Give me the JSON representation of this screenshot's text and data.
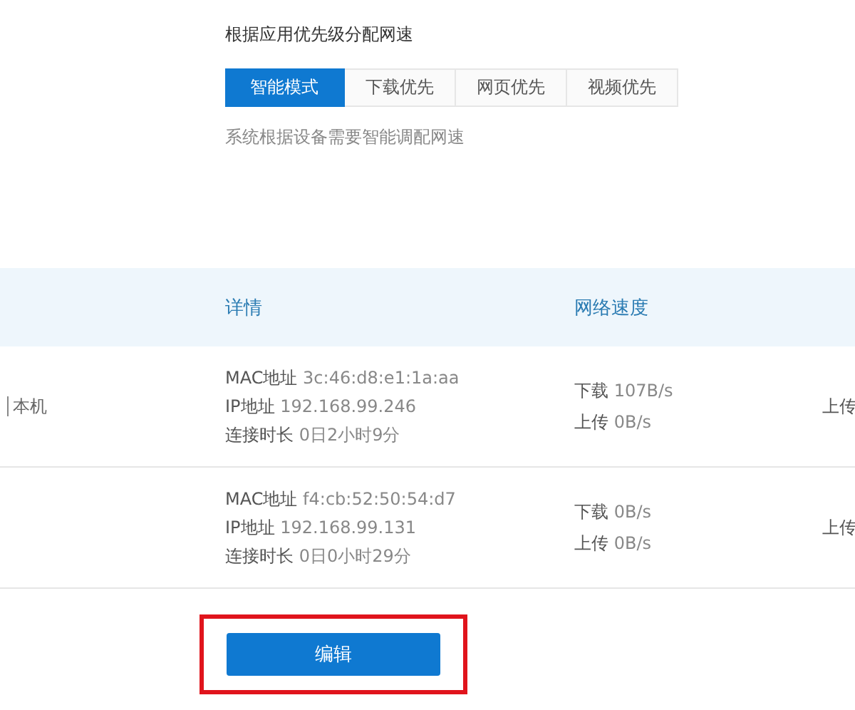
{
  "priority": {
    "title": "根据应用优先级分配网速",
    "tabs": [
      {
        "label": "智能模式",
        "selected": true
      },
      {
        "label": "下载优先",
        "selected": false
      },
      {
        "label": "网页优先",
        "selected": false
      },
      {
        "label": "视频优先",
        "selected": false
      }
    ],
    "description": "系统根据设备需要智能调配网速"
  },
  "table": {
    "columns": [
      "详情",
      "网络速度"
    ],
    "rows": [
      {
        "column_1": "本机",
        "details": [
          {
            "label": "MAC地址",
            "value": "3c:46:d8:e1:1a:aa"
          },
          {
            "label": "IP地址",
            "value": "192.168.99.246"
          },
          {
            "label": "连接时长",
            "value": "0日2小时9分"
          }
        ],
        "speed": [
          {
            "label": "下载",
            "value": "107B/s"
          },
          {
            "label": "上传",
            "value": "0B/s"
          }
        ],
        "column_4": "上传"
      },
      {
        "details": [
          {
            "label": "MAC地址",
            "value": "f4:cb:52:50:54:d7"
          },
          {
            "label": "IP地址",
            "value": "192.168.99.131"
          },
          {
            "label": "连接时长",
            "value": "0日0小时29分"
          }
        ],
        "speed": [
          {
            "label": "下载",
            "value": "0B/s"
          },
          {
            "label": "上传",
            "value": "0B/s"
          }
        ],
        "column_4": "上传"
      }
    ]
  },
  "edit_button": {
    "label": "编辑",
    "highlighted": true
  }
}
